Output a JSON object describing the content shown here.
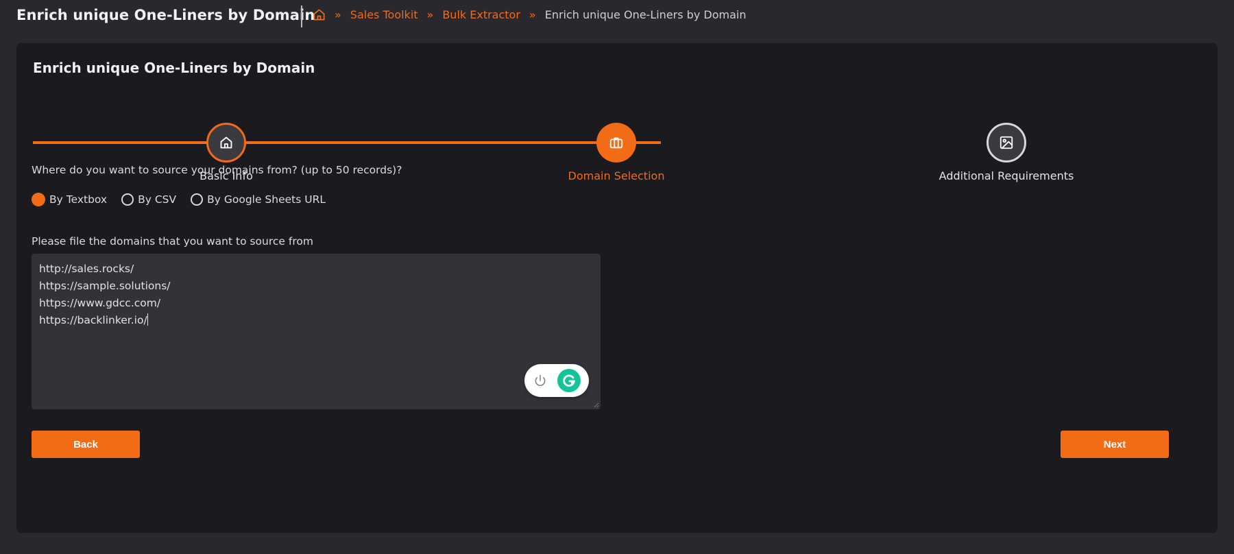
{
  "header": {
    "title": "Enrich unique One-Liners by Domain",
    "home_icon": "home-icon",
    "separator": "»",
    "breadcrumb": [
      {
        "label": "Sales Toolkit",
        "link": true
      },
      {
        "label": "Bulk Extractor",
        "link": true
      },
      {
        "label": "Enrich unique One-Liners by Domain",
        "link": false
      }
    ]
  },
  "card": {
    "title": "Enrich unique One-Liners by Domain"
  },
  "stepper": {
    "steps": [
      {
        "label": "Basic Info",
        "state": "done",
        "icon": "home-icon"
      },
      {
        "label": "Domain Selection",
        "state": "active",
        "icon": "briefcase-icon"
      },
      {
        "label": "Additional Requirements",
        "state": "pending",
        "icon": "image-icon"
      }
    ]
  },
  "form": {
    "question": "Where do you want to source your domains from? (up to 50 records)?",
    "source_options": [
      {
        "label": "By Textbox",
        "checked": true
      },
      {
        "label": "By CSV",
        "checked": false
      },
      {
        "label": "By Google Sheets URL",
        "checked": false
      }
    ],
    "domains_label": "Please file the domains that you want to source from",
    "domains_value": "http://sales.rocks/\nhttps://sample.solutions/\nhttps://www.gdcc.com/\nhttps://backlinker.io/"
  },
  "grammarly": {
    "power_icon": "power-icon",
    "logo_icon": "grammarly-g-icon"
  },
  "buttons": {
    "back_label": "Back",
    "next_label": "Next"
  },
  "colors": {
    "accent": "#f26b16",
    "page_bg": "#29282e",
    "card_bg": "#1b1a1f",
    "input_bg": "#333239",
    "grammarly_green": "#15c39a"
  }
}
